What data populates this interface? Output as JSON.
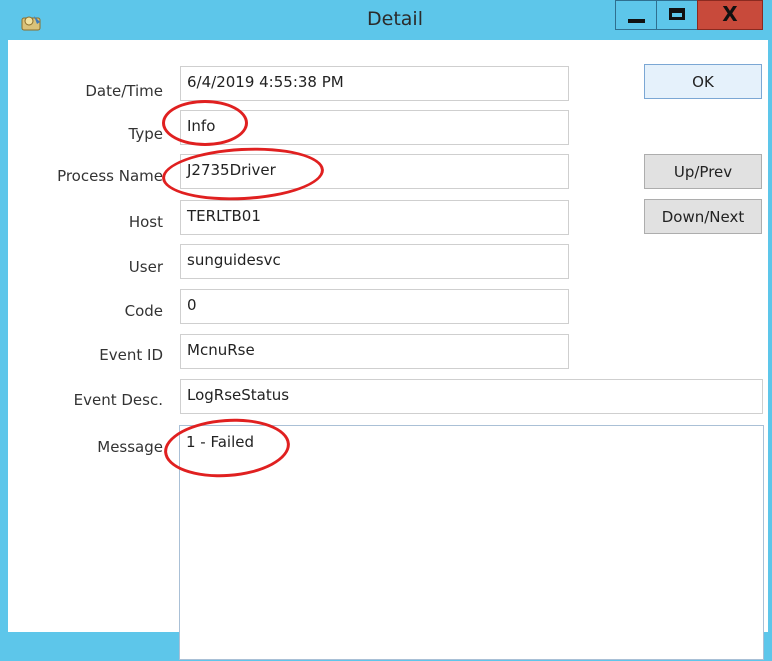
{
  "window": {
    "title": "Detail",
    "close_label": "X",
    "accent_color": "#5dc6ea",
    "close_color": "#c84a3b"
  },
  "labels": {
    "datetime": "Date/Time",
    "type": "Type",
    "process_name": "Process Name",
    "host": "Host",
    "user": "User",
    "code": "Code",
    "event_id": "Event ID",
    "event_desc": "Event Desc.",
    "message": "Message"
  },
  "fields": {
    "datetime": "6/4/2019 4:55:38 PM",
    "type": "Info",
    "process_name": "J2735Driver",
    "host": "TERLTB01",
    "user": "sunguidesvc",
    "code": "0",
    "event_id": "McnuRse",
    "event_desc": "LogRseStatus",
    "message": "1 - Failed"
  },
  "buttons": {
    "ok": "OK",
    "up_prev": "Up/Prev",
    "down_next": "Down/Next"
  },
  "annotations": {
    "color": "#e02020",
    "circled": [
      "Type",
      "Process Name",
      "Message"
    ]
  }
}
